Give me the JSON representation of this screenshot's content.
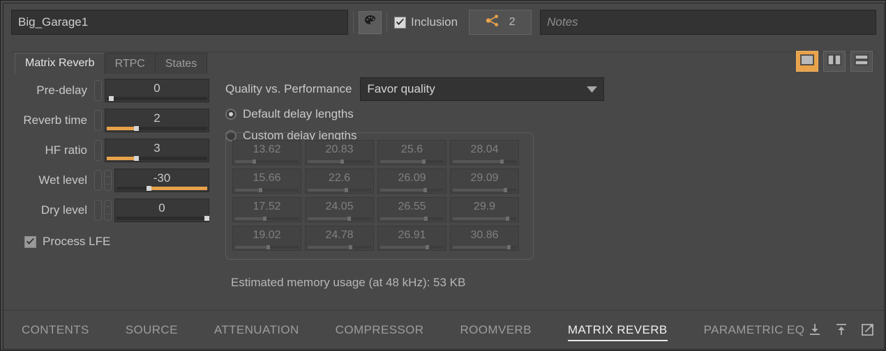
{
  "header": {
    "name_value": "Big_Garage1",
    "palette_icon": "palette-icon",
    "inclusion_label": "Inclusion",
    "share_icon": "share-nodes-icon",
    "share_count": "2",
    "notes_placeholder": "Notes"
  },
  "tabs": [
    {
      "label": "Matrix Reverb",
      "active": true
    },
    {
      "label": "RTPC",
      "active": false
    },
    {
      "label": "States",
      "active": false
    }
  ],
  "layout_buttons": [
    {
      "name": "layout-single-pane-button",
      "active": true
    },
    {
      "name": "layout-vertical-split-button",
      "active": false
    },
    {
      "name": "layout-horizontal-split-button",
      "active": false
    }
  ],
  "parameters": [
    {
      "label": "Pre-delay",
      "value": "0",
      "fill_pct": 0,
      "handle_pct": 2,
      "knobs": 1
    },
    {
      "label": "Reverb time",
      "value": "2",
      "fill_pct": 27,
      "handle_pct": 27,
      "knobs": 1
    },
    {
      "label": "HF ratio",
      "value": "3",
      "fill_pct": 27,
      "handle_pct": 27,
      "knobs": 1
    },
    {
      "label": "Wet level",
      "value": "-30",
      "fill_pct": 100,
      "handle_pct": 33,
      "knobs": 2
    },
    {
      "label": "Dry level",
      "value": "0",
      "fill_pct": 0,
      "handle_pct": 98,
      "knobs": 2
    }
  ],
  "process_lfe": {
    "label": "Process LFE",
    "checked": true
  },
  "quality": {
    "label": "Quality vs. Performance",
    "selected": "Favor quality",
    "options": [
      "Favor quality"
    ],
    "chevron_icon": "chevron-down-icon"
  },
  "delay_mode": {
    "options": [
      {
        "label": "Default delay lengths",
        "selected": true
      },
      {
        "label": "Custom delay lengths",
        "selected": false
      }
    ]
  },
  "delay_cells": [
    {
      "value": "13.62",
      "fill_pct": 28
    },
    {
      "value": "20.83",
      "fill_pct": 52
    },
    {
      "value": "25.6",
      "fill_pct": 66
    },
    {
      "value": "28.04",
      "fill_pct": 75
    },
    {
      "value": "15.66",
      "fill_pct": 37
    },
    {
      "value": "22.6",
      "fill_pct": 58
    },
    {
      "value": "26.09",
      "fill_pct": 68
    },
    {
      "value": "29.09",
      "fill_pct": 80
    },
    {
      "value": "17.52",
      "fill_pct": 44
    },
    {
      "value": "24.05",
      "fill_pct": 63
    },
    {
      "value": "26.55",
      "fill_pct": 69
    },
    {
      "value": "29.9",
      "fill_pct": 83
    },
    {
      "value": "19.02",
      "fill_pct": 49
    },
    {
      "value": "24.78",
      "fill_pct": 65
    },
    {
      "value": "26.91",
      "fill_pct": 71
    },
    {
      "value": "30.86",
      "fill_pct": 86
    }
  ],
  "memory_note": "Estimated memory usage (at 48 kHz): 53 KB",
  "bottom_tabs": [
    {
      "label": "CONTENTS",
      "active": false
    },
    {
      "label": "SOURCE",
      "active": false
    },
    {
      "label": "ATTENUATION",
      "active": false
    },
    {
      "label": "COMPRESSOR",
      "active": false
    },
    {
      "label": "ROOMVERB",
      "active": false
    },
    {
      "label": "MATRIX REVERB",
      "active": true
    },
    {
      "label": "PARAMETRIC EQ",
      "active": false
    }
  ],
  "bottom_icons": [
    {
      "name": "import-download-icon"
    },
    {
      "name": "export-upload-icon"
    },
    {
      "name": "open-external-icon"
    }
  ],
  "colors": {
    "accent": "#e8a24a",
    "panel_bg": "#484848",
    "field_bg": "#333333",
    "text": "#c9c9c9",
    "text_dim": "#8d8d8d"
  }
}
